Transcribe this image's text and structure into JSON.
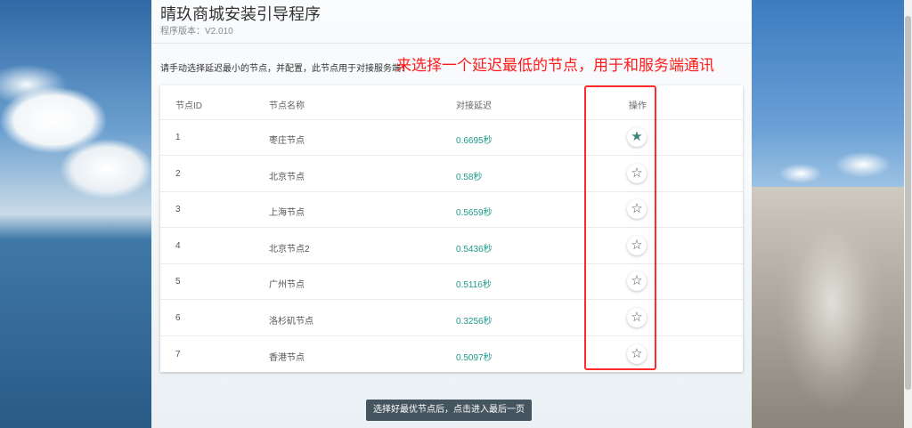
{
  "header": {
    "title": "晴玖商城安装引导程序",
    "version": "程序版本：V2.010"
  },
  "intro_text": "请手动选择延迟最小的节点，并配置，此节点用于对接服务端！",
  "annotation": "来选择一个延迟最低的节点，用于和服务端通讯",
  "table": {
    "columns": [
      "节点ID",
      "节点名称",
      "对接延迟",
      "操作"
    ],
    "rows": [
      {
        "id": "1",
        "name": "枣庄节点",
        "latency": "0.6695秒",
        "starred": true
      },
      {
        "id": "2",
        "name": "北京节点",
        "latency": "0.58秒",
        "starred": false
      },
      {
        "id": "3",
        "name": "上海节点",
        "latency": "0.5659秒",
        "starred": false
      },
      {
        "id": "4",
        "name": "北京节点2",
        "latency": "0.5436秒",
        "starred": false
      },
      {
        "id": "5",
        "name": "广州节点",
        "latency": "0.5116秒",
        "starred": false
      },
      {
        "id": "6",
        "name": "洛杉矶节点",
        "latency": "0.3256秒",
        "starred": false
      },
      {
        "id": "7",
        "name": "香港节点",
        "latency": "0.5097秒",
        "starred": false
      }
    ]
  },
  "next_button": "选择好最优节点后，点击进入最后一页",
  "icons": {
    "starred": "star-filled-icon",
    "unstarred": "star-outline-icon"
  },
  "colors": {
    "latency": "#1f9a8a",
    "annotation": "#ff1a1a",
    "button": "#455560",
    "star_active": "#3e8478"
  }
}
